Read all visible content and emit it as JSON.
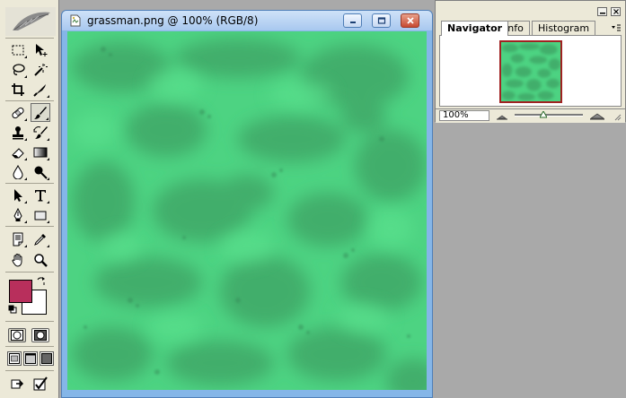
{
  "document": {
    "title": "grassman.png @ 100% (RGB/8)",
    "canvas_base_color": "#4dd382",
    "canvas_dark_color": "#3fa868"
  },
  "toolbox": {
    "tools": [
      "rectangular-marquee",
      "move",
      "lasso",
      "magic-wand",
      "crop",
      "slice",
      "healing-brush",
      "brush",
      "clone-stamp",
      "history-brush",
      "eraser",
      "gradient",
      "blur",
      "dodge",
      "path-selection",
      "type",
      "pen",
      "rectangle-shape",
      "notes",
      "eyedropper",
      "hand",
      "zoom"
    ],
    "active_tool": "brush",
    "foreground_color": "#b82f5c",
    "background_color": "#ffffff"
  },
  "navigator": {
    "tabs": [
      {
        "label": "Navigator",
        "active": true
      },
      {
        "label": "Info",
        "active": false
      },
      {
        "label": "Histogram",
        "active": false
      }
    ],
    "zoom_value": "100%",
    "zoom_slider_position": 0.42,
    "view_box_color": "#a02222"
  }
}
